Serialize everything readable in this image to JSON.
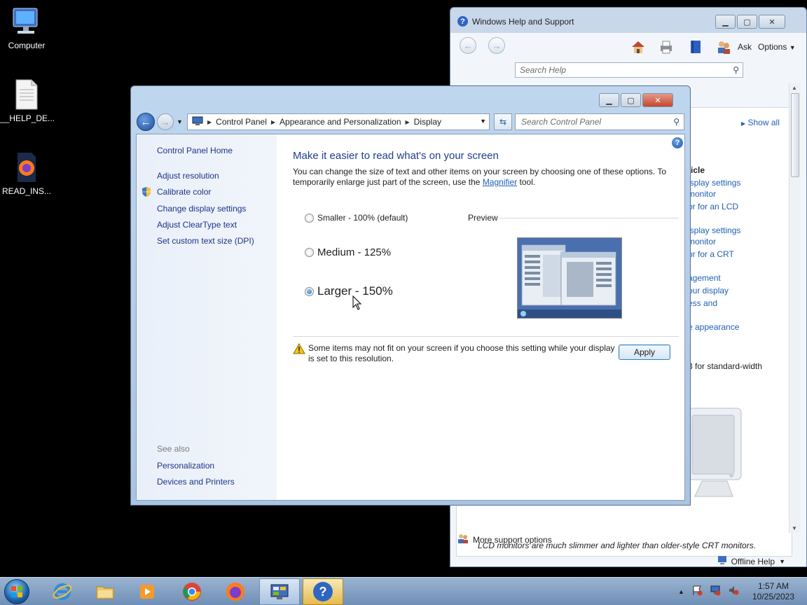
{
  "desktop": {
    "icons": [
      {
        "label": "Computer"
      },
      {
        "label": "__HELP_DE..."
      },
      {
        "label": "READ_INS..."
      }
    ]
  },
  "help_window": {
    "title": "Windows Help and Support",
    "toolbar": {
      "ask": "Ask",
      "options": "Options"
    },
    "search_placeholder": "Search Help",
    "show_all": "Show all",
    "links": [
      {
        "text": "ticle"
      },
      {
        "text": "isplay settings"
      },
      {
        "text": "monitor"
      },
      {
        "text": "or for an LCD"
      },
      {
        "text": "isplay settings"
      },
      {
        "text": "monitor"
      },
      {
        "text": "or for a CRT"
      },
      {
        "text": "agement"
      },
      {
        "text": "our display"
      },
      {
        "text": "ess and"
      },
      {
        "text": "e appearance"
      },
      {
        "text": "3 for standard-width"
      }
    ],
    "caption": "LCD monitors are much slimmer and lighter than older-style CRT monitors.",
    "more_support": "More support options",
    "offline_help": "Offline Help"
  },
  "control_panel": {
    "breadcrumb": [
      "Control Panel",
      "Appearance and Personalization",
      "Display"
    ],
    "search_placeholder": "Search Control Panel",
    "left_nav": {
      "home": "Control Panel Home",
      "items": [
        "Adjust resolution",
        "Calibrate color",
        "Change display settings",
        "Adjust ClearType text",
        "Set custom text size (DPI)"
      ],
      "see_also_label": "See also",
      "see_also": [
        "Personalization",
        "Devices and Printers"
      ]
    },
    "heading": "Make it easier to read what's on your screen",
    "description_pre": "You can change the size of text and other items on your screen by choosing one of these options. To temporarily enlarge just part of the screen, use the ",
    "description_link": "Magnifier",
    "description_post": " tool.",
    "options": [
      {
        "label": "Smaller - 100% (default)",
        "checked": false
      },
      {
        "label": "Medium - 125%",
        "checked": false
      },
      {
        "label": "Larger - 150%",
        "checked": true
      }
    ],
    "preview_label": "Preview",
    "warning": "Some items may not fit on your screen if you choose this setting while your display is set to this resolution.",
    "apply": "Apply"
  },
  "taskbar": {
    "clock_time": "1:57 AM",
    "clock_date": "10/25/2023"
  }
}
